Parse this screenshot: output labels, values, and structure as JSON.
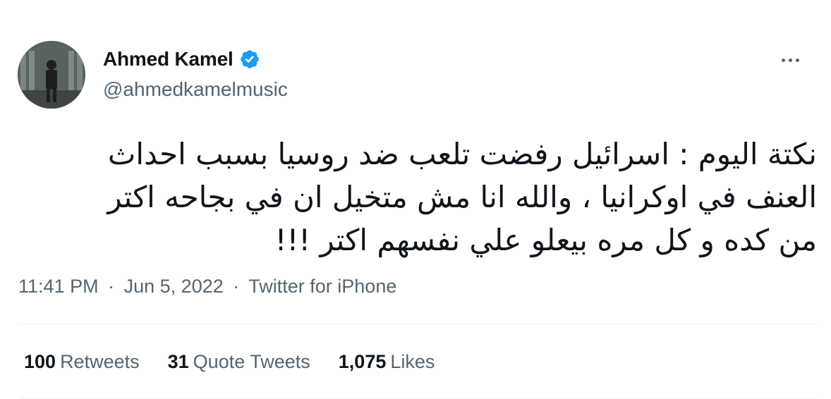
{
  "author": {
    "display_name": "Ahmed Kamel",
    "handle": "@ahmedkamelmusic",
    "verified": true,
    "verified_color": "#1d9bf0"
  },
  "tweet": {
    "lines": [
      "نكتة اليوم : اسرائيل رفضت تلعب ضد روسيا بسبب احداث",
      "العنف في اوكرانيا ، والله انا مش متخيل ان في بجاحه اكتر",
      "من كده و كل مره بيعلو علي نفسهم اكتر !!!"
    ],
    "time": "11:41 PM",
    "date": "Jun 5, 2022",
    "source": "Twitter for iPhone",
    "separator": "·"
  },
  "stats": {
    "retweets": {
      "count": "100",
      "label": "Retweets"
    },
    "quotes": {
      "count": "31",
      "label": "Quote Tweets"
    },
    "likes": {
      "count": "1,075",
      "label": "Likes"
    }
  },
  "icons": {
    "more": "more-horizontal-icon",
    "verified": "verified-badge-icon"
  },
  "colors": {
    "text_primary": "#0f1419",
    "text_secondary": "#536471",
    "divider": "#eff3f4"
  }
}
